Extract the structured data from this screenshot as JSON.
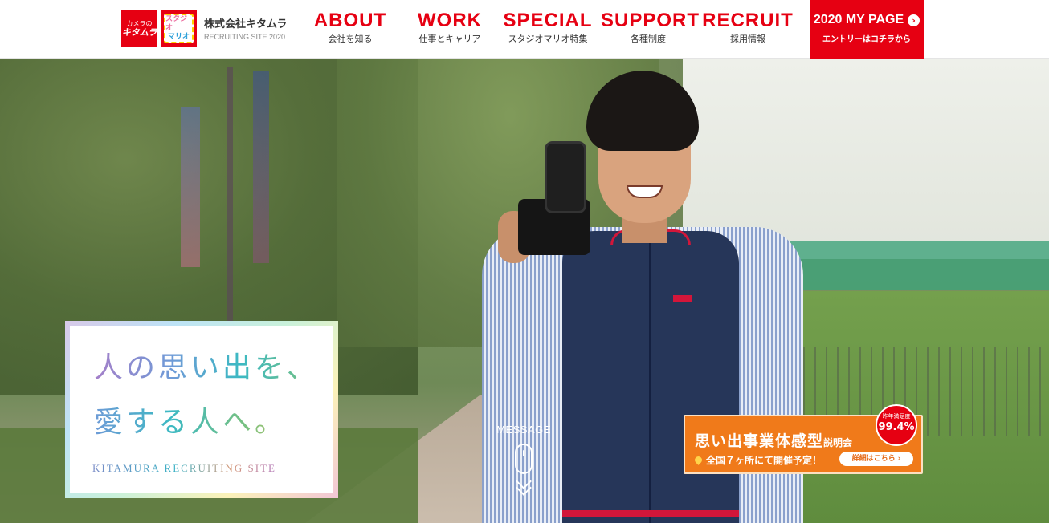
{
  "header": {
    "logo_kitamura": {
      "small": "カメラの",
      "big": "キタムラ"
    },
    "logo_mario": {
      "line1": "スタジオ",
      "line2": "マリオ"
    },
    "company_name": "株式会社キタムラ",
    "site_label": "RECRUITING SITE 2020",
    "nav": [
      {
        "en": "ABOUT",
        "jp": "会社を知る"
      },
      {
        "en": "WORK",
        "jp": "仕事とキャリア"
      },
      {
        "en": "SPECIAL",
        "jp": "スタジオマリオ特集"
      },
      {
        "en": "SUPPORT",
        "jp": "各種制度"
      },
      {
        "en": "RECRUIT",
        "jp": "採用情報"
      }
    ],
    "mypage": {
      "title": "2020 MY PAGE",
      "sub": "エントリーはコチラから"
    }
  },
  "hero": {
    "catch_line1": "人の思い出を、",
    "catch_line2": "愛する人へ。",
    "catch_sub": "KITAMURA RECRUITING SITE",
    "message_label": "MESSAGE"
  },
  "event_banner": {
    "title": "思い出事業体感型",
    "title_suffix": "説明会",
    "place": "全国７ヶ所にて開催予定！",
    "detail_button": "詳細はこちら",
    "badge_label": "昨年満足度",
    "badge_value": "99.4%"
  },
  "colors": {
    "brand_red": "#e60012",
    "event_orange": "#f07a1a"
  }
}
